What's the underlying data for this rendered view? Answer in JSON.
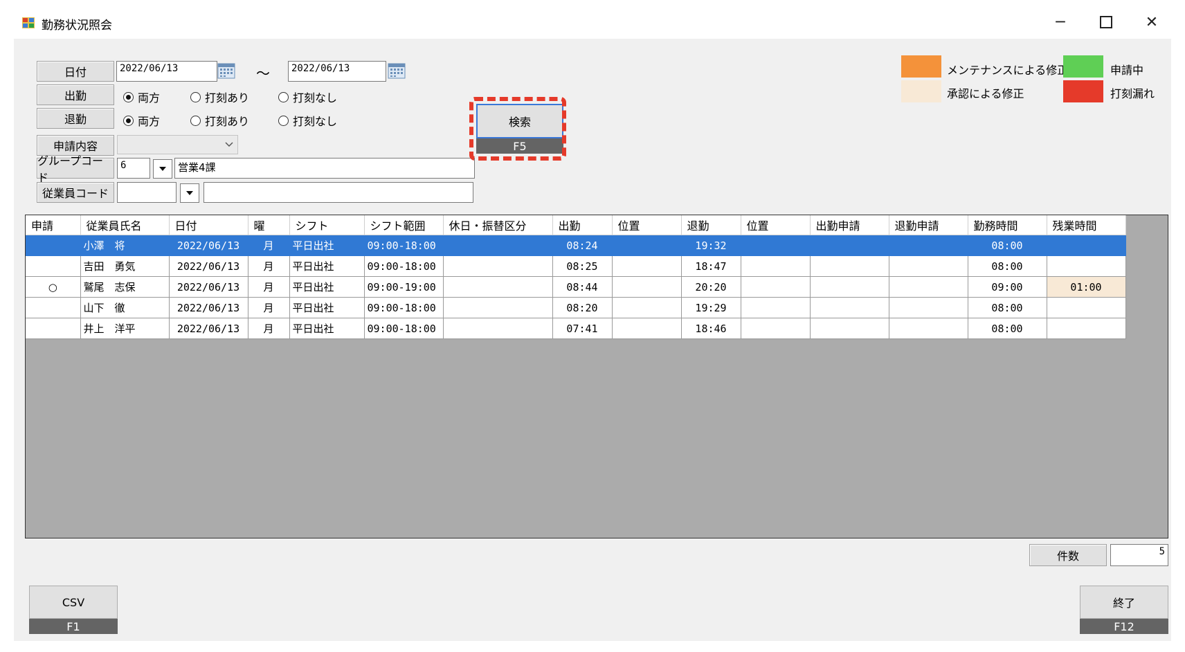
{
  "window": {
    "title": "勤務状況照会"
  },
  "filters": {
    "date_label": "日付",
    "date_from": "2022/06/13",
    "tilde": "～",
    "date_to": "2022/06/13",
    "clock_in_label": "出勤",
    "clock_out_label": "退勤",
    "radio_options": [
      "両方",
      "打刻あり",
      "打刻なし"
    ],
    "application_label": "申請内容",
    "group_code_label": "グループコード",
    "group_code_value": "6",
    "group_name_value": "営業4課",
    "employee_code_label": "従業員コード"
  },
  "search": {
    "label": "検索",
    "key": "F5"
  },
  "legend": {
    "maintenance": "メンテナンスによる修正",
    "approval": "承認による修正",
    "applying": "申請中",
    "missing": "打刻漏れ",
    "colors": {
      "maintenance": "#f4923a",
      "approval": "#f8e9d6",
      "applying": "#5fcf55",
      "missing": "#e53a2a"
    }
  },
  "table": {
    "columns": [
      "申請",
      "従業員氏名",
      "日付",
      "曜",
      "シフト",
      "シフト範囲",
      "休日・振替区分",
      "出勤",
      "位置",
      "退勤",
      "位置",
      "出勤申請",
      "退勤申請",
      "勤務時間",
      "残業時間"
    ],
    "rows": [
      [
        "",
        "小澤　将",
        "2022/06/13",
        "月",
        "平日出社",
        "09:00-18:00",
        "",
        "08:24",
        "",
        "19:32",
        "",
        "",
        "",
        "08:00",
        ""
      ],
      [
        "",
        "吉田　勇気",
        "2022/06/13",
        "月",
        "平日出社",
        "09:00-18:00",
        "",
        "08:25",
        "",
        "18:47",
        "",
        "",
        "",
        "08:00",
        ""
      ],
      [
        "○",
        "鷲尾　志保",
        "2022/06/13",
        "月",
        "平日出社",
        "09:00-19:00",
        "",
        "08:44",
        "",
        "20:20",
        "",
        "",
        "",
        "09:00",
        "01:00"
      ],
      [
        "",
        "山下　徹",
        "2022/06/13",
        "月",
        "平日出社",
        "09:00-18:00",
        "",
        "08:20",
        "",
        "19:29",
        "",
        "",
        "",
        "08:00",
        ""
      ],
      [
        "",
        "井上　洋平",
        "2022/06/13",
        "月",
        "平日出社",
        "09:00-18:00",
        "",
        "07:41",
        "",
        "18:46",
        "",
        "",
        "",
        "08:00",
        ""
      ]
    ]
  },
  "count": {
    "label": "件数",
    "value": "5"
  },
  "csv_button": {
    "label": "CSV",
    "key": "F1"
  },
  "exit_button": {
    "label": "終了",
    "key": "F12"
  }
}
